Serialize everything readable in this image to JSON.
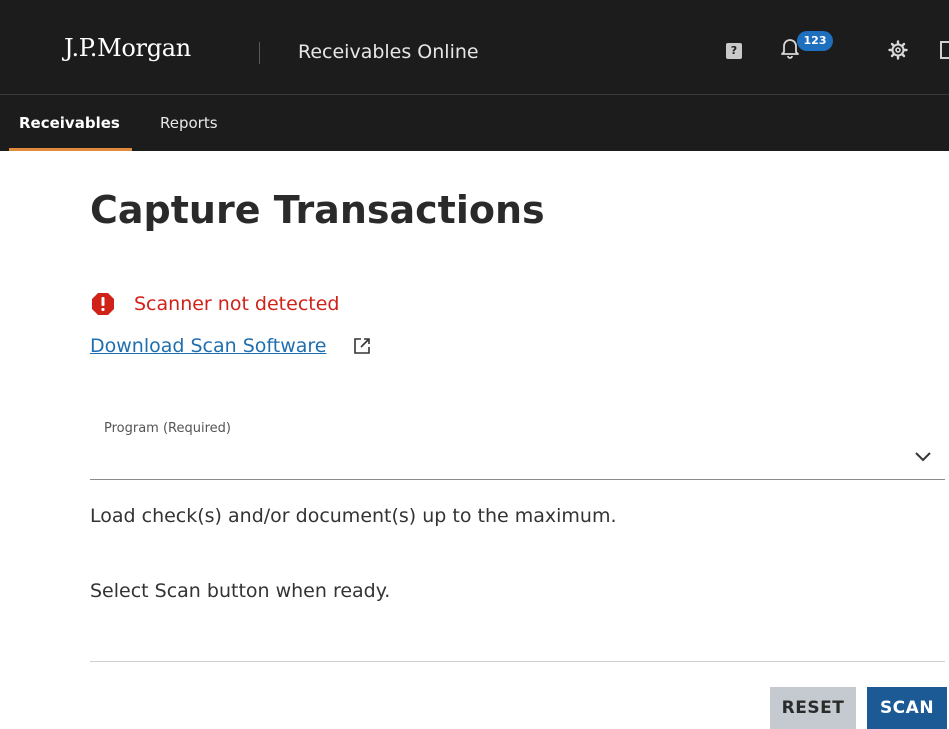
{
  "header": {
    "logo": "J.P.Morgan",
    "app_title": "Receivables Online",
    "help_label": "?",
    "notifications_count": "123"
  },
  "tabs": [
    {
      "label": "Receivables",
      "active": true
    },
    {
      "label": "Reports",
      "active": false
    }
  ],
  "main": {
    "title": "Capture Transactions",
    "alert": "Scanner not detected",
    "download_link": "Download Scan Software",
    "program_field_label": "Program (Required)",
    "program_value": "",
    "instruction_1": "Load check(s) and/or document(s) up to the maximum.",
    "instruction_2": "Select Scan button when ready."
  },
  "buttons": {
    "reset": "RESET",
    "scan": "SCAN"
  },
  "colors": {
    "header_bg": "#1c1c1c",
    "tab_accent": "#e08a3b",
    "alert_red": "#d1221a",
    "link_blue": "#1f6fb0",
    "badge_blue": "#1f6fbf",
    "scan_button": "#1c5a96",
    "reset_button": "#c4cacf"
  },
  "icons": {
    "help": "help-icon",
    "notifications": "bell-icon",
    "settings": "gear-icon",
    "alert": "alert-octagon-icon",
    "external": "external-link-icon",
    "dropdown": "chevron-down-icon"
  }
}
